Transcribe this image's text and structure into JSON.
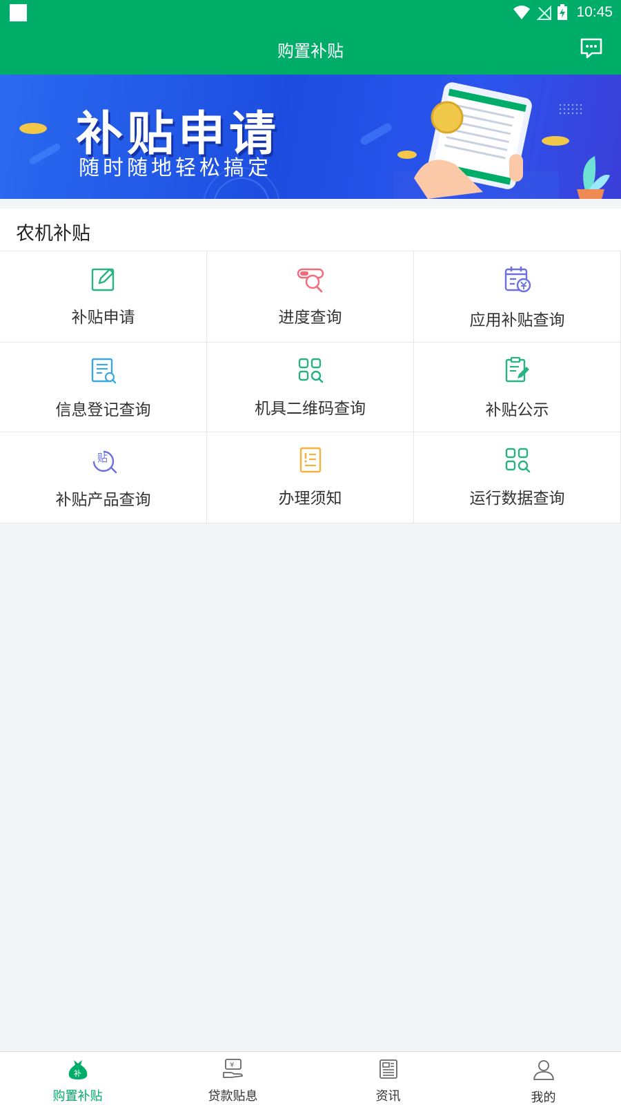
{
  "status_bar": {
    "time": "10:45"
  },
  "header": {
    "title": "购置补贴"
  },
  "banner": {
    "title": "补贴申请",
    "subtitle": "随时随地轻松搞定"
  },
  "section": {
    "title": "农机补贴",
    "items": [
      {
        "label": "补贴申请",
        "icon": "edit-icon"
      },
      {
        "label": "进度查询",
        "icon": "progress-search-icon"
      },
      {
        "label": "应用补贴查询",
        "icon": "calendar-yuan-icon"
      },
      {
        "label": "信息登记查询",
        "icon": "document-search-icon"
      },
      {
        "label": "机具二维码查询",
        "icon": "qrcode-search-icon"
      },
      {
        "label": "补贴公示",
        "icon": "notice-edit-icon"
      },
      {
        "label": "补贴产品查询",
        "icon": "subsidy-product-search-icon"
      },
      {
        "label": "办理须知",
        "icon": "notice-list-icon"
      },
      {
        "label": "运行数据查询",
        "icon": "grid-search-icon"
      }
    ]
  },
  "bottom_nav": {
    "items": [
      {
        "label": "购置补贴",
        "icon": "money-bag-icon",
        "active": true
      },
      {
        "label": "贷款贴息",
        "icon": "loan-hand-icon"
      },
      {
        "label": "资讯",
        "icon": "news-icon"
      },
      {
        "label": "我的",
        "icon": "user-icon"
      }
    ]
  },
  "colors": {
    "primary": "#00ad68",
    "banner_blue": "#1d4de0",
    "icon_green": "#26b37f",
    "icon_red": "#f36a7a",
    "icon_purple": "#6b6fe0",
    "icon_blue": "#3aa8e8",
    "icon_orange": "#f5b23c"
  }
}
